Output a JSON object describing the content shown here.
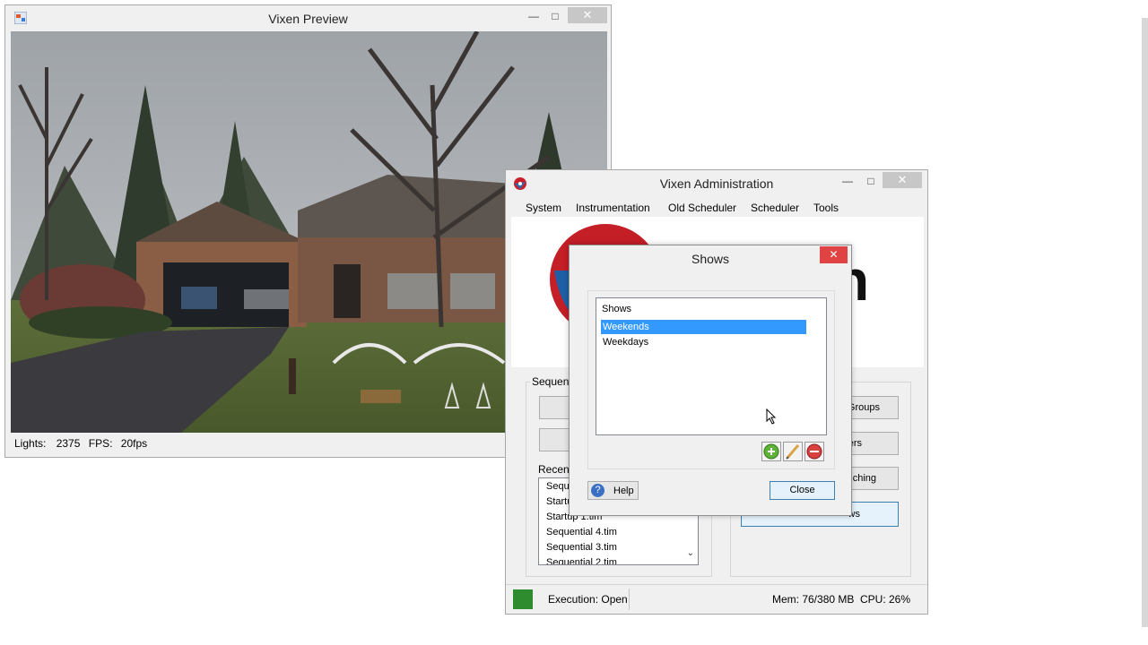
{
  "preview": {
    "title": "Vixen Preview",
    "minimize": "—",
    "maximize": "□",
    "close": "✕",
    "status": {
      "lights_label": "Lights:",
      "lights_value": "2375",
      "fps_label": "FPS:",
      "fps_value": "20fps"
    }
  },
  "admin": {
    "title": "Vixen Administration",
    "minimize": "—",
    "maximize": "□",
    "close": "✕",
    "menu": [
      "System",
      "Instrumentation",
      "Old Scheduler",
      "Scheduler",
      "Tools"
    ],
    "logo_text": "n",
    "sequences_group": "Sequenc",
    "recent_label": "Recent",
    "recent_items": [
      "Seque",
      "Startu",
      "Startup 1.tim",
      "Sequential 4.tim",
      "Sequential 3.tim",
      "Sequential 2.tim"
    ],
    "right_buttons": [
      "Groups",
      "ers",
      "ching",
      "ws"
    ],
    "status": {
      "execution": "Execution: Open",
      "memory": "Mem: 76/380 MB",
      "cpu": "CPU: 26%",
      "indicator_color": "#2e8b2e"
    }
  },
  "shows_dialog": {
    "title": "Shows",
    "close": "✕",
    "list_header": "Shows",
    "items": [
      "Weekends",
      "Weekdays"
    ],
    "selected_color": "#3399ff",
    "help_label": "Help",
    "close_label": "Close",
    "add_icon": "plus-icon",
    "edit_icon": "pencil-icon",
    "delete_icon": "minus-icon"
  }
}
